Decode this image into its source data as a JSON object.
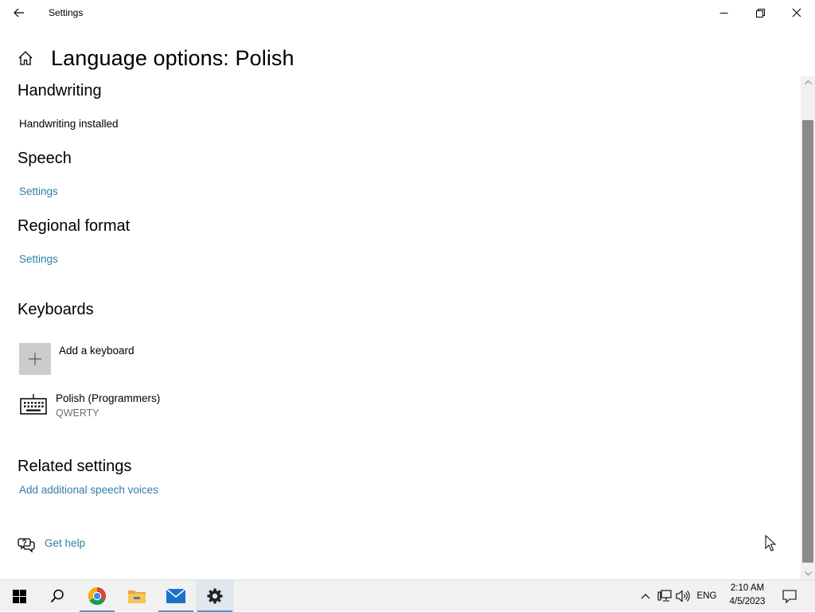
{
  "window": {
    "title": "Settings",
    "minimize_icon": "minimize-icon",
    "restore_icon": "restore-icon",
    "close_icon": "close-icon"
  },
  "page": {
    "title": "Language options: Polish",
    "home_icon": "home-icon"
  },
  "sections": {
    "handwriting": {
      "heading": "Handwriting",
      "status": "Handwriting installed"
    },
    "speech": {
      "heading": "Speech",
      "link": "Settings"
    },
    "regional": {
      "heading": "Regional format",
      "link": "Settings"
    },
    "keyboards": {
      "heading": "Keyboards",
      "add_label": "Add a keyboard",
      "items": [
        {
          "name": "Polish (Programmers)",
          "layout": "QWERTY"
        }
      ]
    },
    "related": {
      "heading": "Related settings",
      "link": "Add additional speech voices"
    },
    "help": {
      "label": "Get help"
    }
  },
  "taskbar": {
    "apps": [
      "start-icon",
      "search-icon",
      "chrome-icon",
      "file-explorer-icon",
      "mail-icon",
      "settings-icon"
    ],
    "active_app": "settings-icon",
    "tray": {
      "language": "ENG",
      "time": "2:10 AM",
      "date": "4/5/2023"
    }
  },
  "colors": {
    "accent": "#0078d7",
    "link": "#2e7ea8",
    "taskbar": "#f1f1f1"
  }
}
